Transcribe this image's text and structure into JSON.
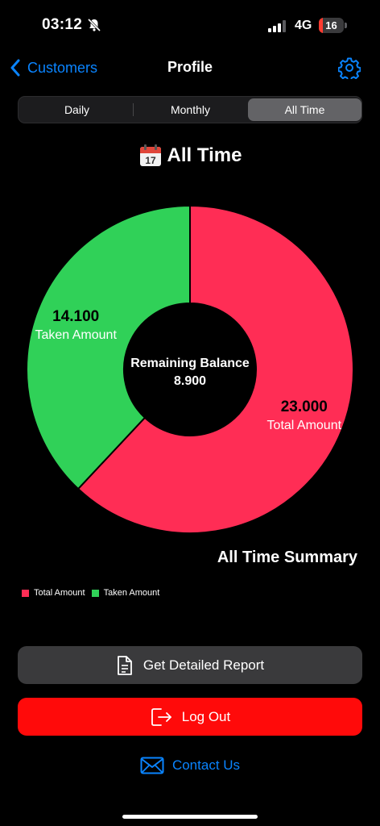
{
  "status_bar": {
    "time": "03:12",
    "network": "4G",
    "battery_level": "16",
    "icons": {
      "silent": "bell-slash-icon",
      "signal": "signal-bars-icon",
      "battery": "battery-icon"
    }
  },
  "nav": {
    "back_label": "Customers",
    "title": "Profile",
    "icons": {
      "back": "chevron-left-icon",
      "settings": "gear-icon"
    }
  },
  "segments": [
    {
      "label": "Daily",
      "selected": false
    },
    {
      "label": "Monthly",
      "selected": false
    },
    {
      "label": "All Time",
      "selected": true
    }
  ],
  "period_heading": {
    "icon": "calendar-icon",
    "text": "All Time"
  },
  "chart_data": {
    "type": "pie",
    "title": "",
    "categories": [
      "Total Amount",
      "Taken Amount"
    ],
    "values": [
      23.0,
      14.1
    ],
    "value_labels": [
      "23.000",
      "14.100"
    ],
    "colors": [
      "#ff2d55",
      "#30d158"
    ],
    "center_label": "Remaining Balance",
    "center_value": "8.900",
    "donut": true,
    "legend_position": "bottom-left"
  },
  "summary_title": "All Time Summary",
  "buttons": {
    "report": {
      "label": "Get Detailed Report",
      "icon": "document-icon"
    },
    "logout": {
      "label": "Log Out",
      "icon": "logout-icon"
    },
    "contact": {
      "label": "Contact Us",
      "icon": "envelope-icon"
    }
  },
  "colors": {
    "accent": "#0a84ff",
    "danger": "#ff0a0a",
    "total": "#ff2d55",
    "taken": "#30d158",
    "battery_low": "#ff3b30"
  }
}
